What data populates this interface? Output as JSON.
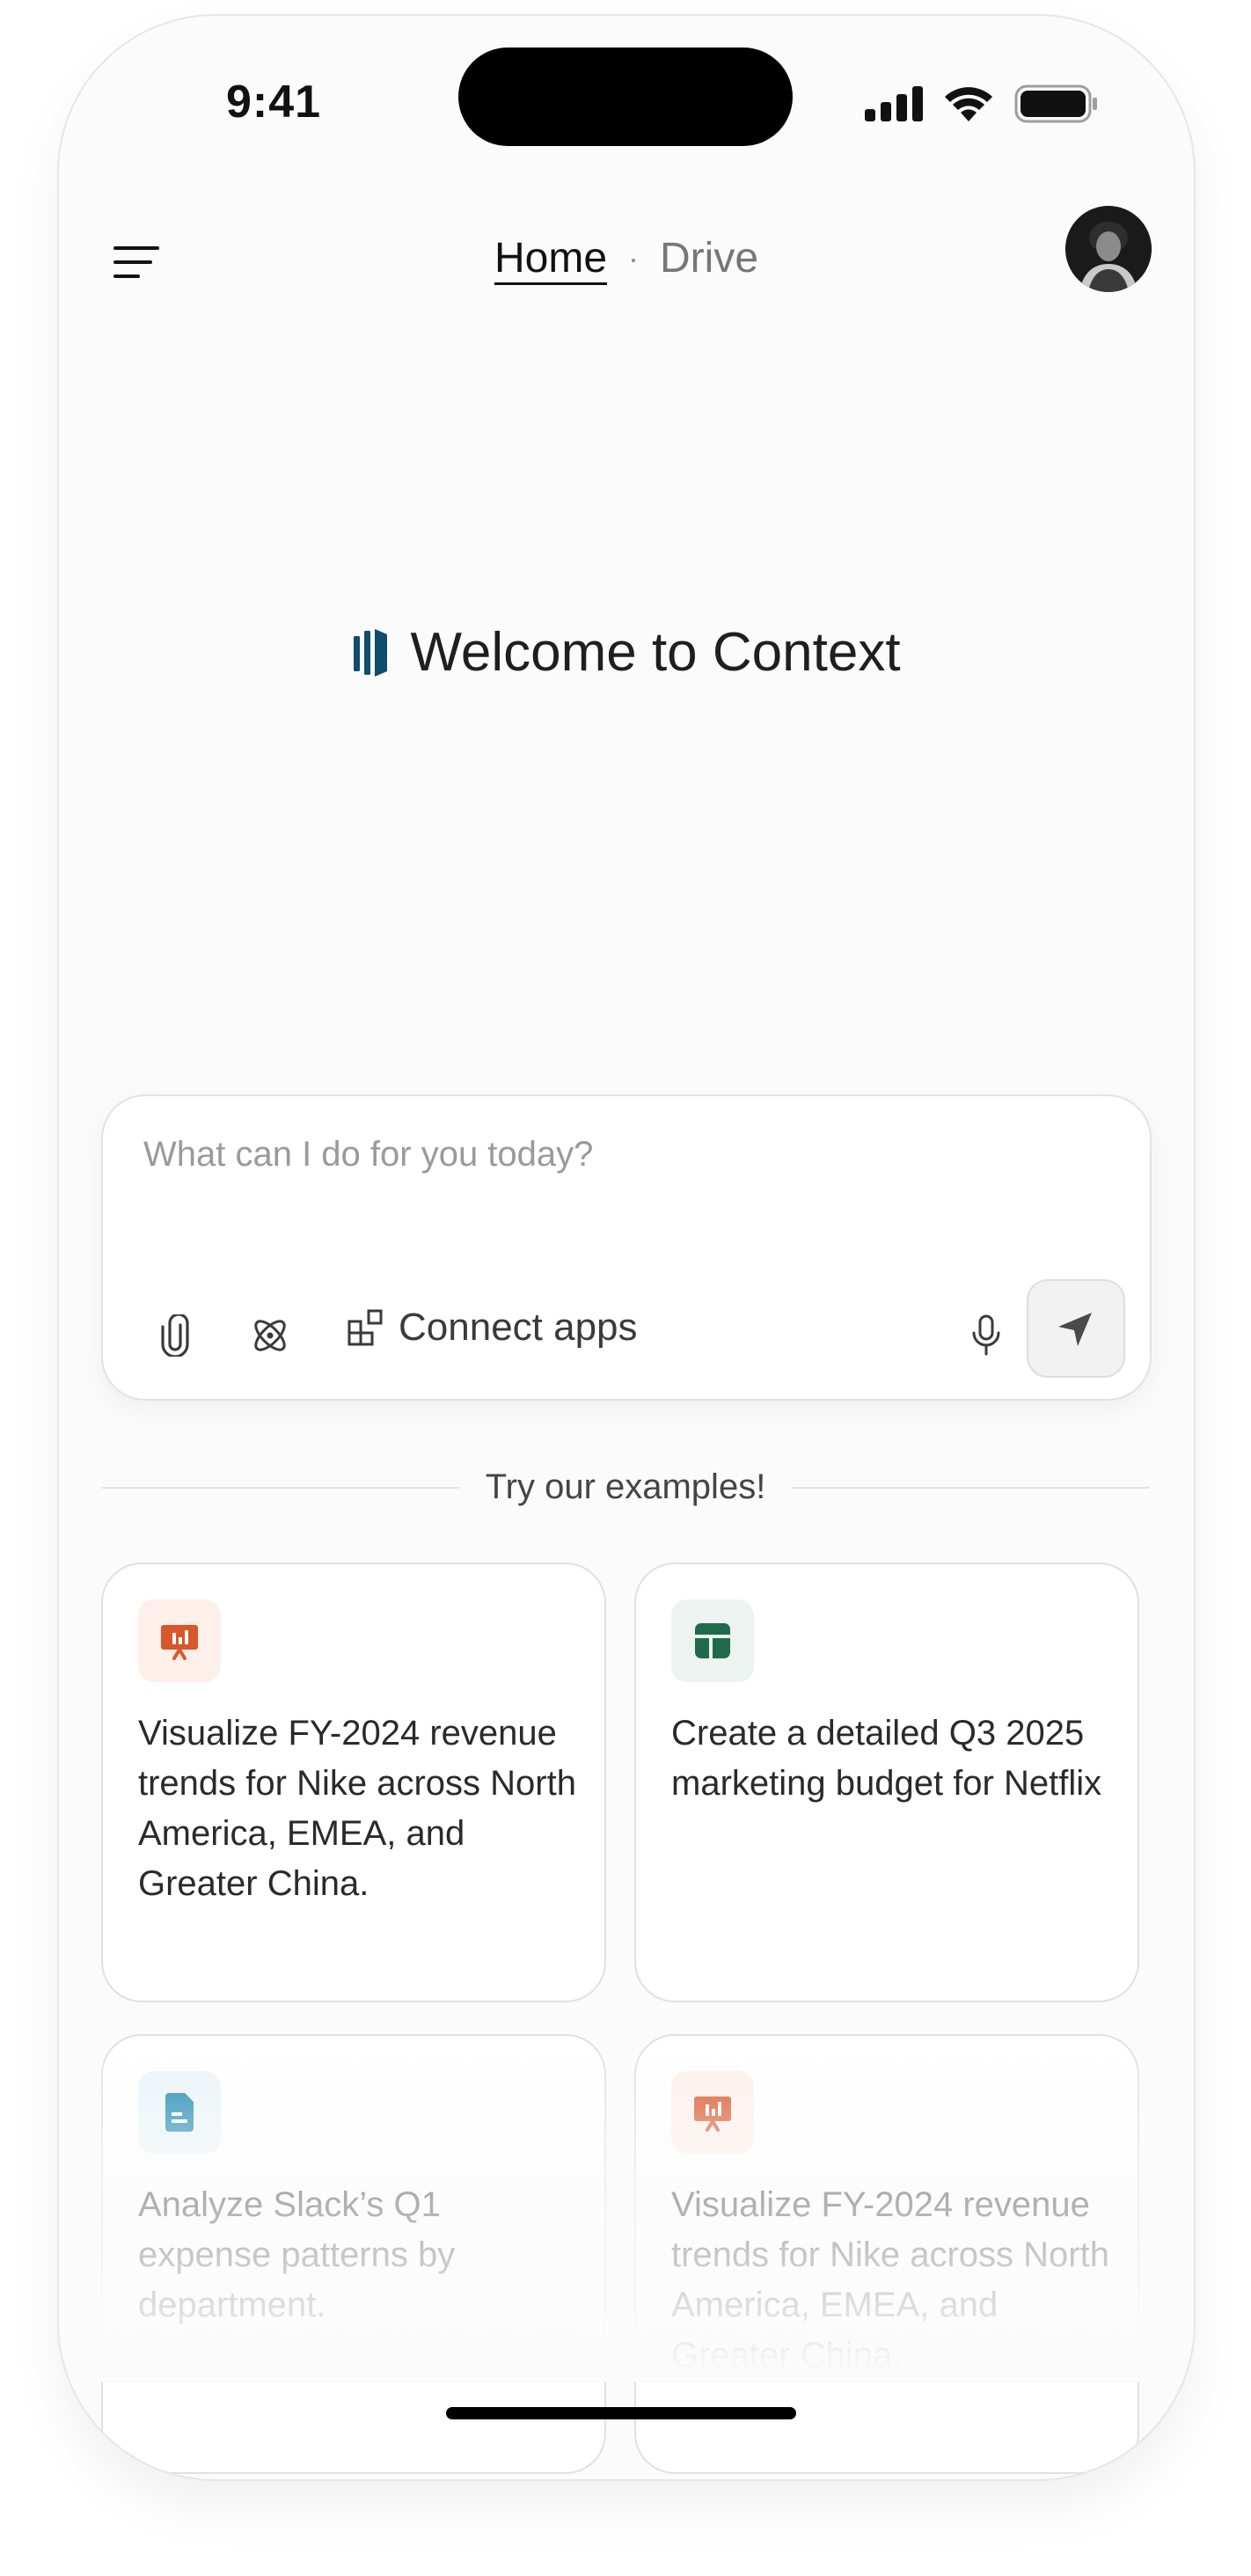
{
  "status_bar": {
    "time": "9:41"
  },
  "header": {
    "tabs": [
      {
        "label": "Home",
        "active": true
      },
      {
        "label": "Drive",
        "active": false
      }
    ],
    "separator": "·"
  },
  "welcome": {
    "title": "Welcome to Context",
    "logo_color": "#0f4c6e"
  },
  "composer": {
    "placeholder": "What can I do for you today?",
    "connect_label": "Connect apps",
    "icons": [
      "paperclip-icon",
      "atom-icon",
      "apps-icon",
      "microphone-icon",
      "send-icon"
    ]
  },
  "examples": {
    "heading": "Try our examples!",
    "cards": [
      {
        "text": "Visualize FY-2024 revenue trends for Nike across North America, EMEA, and Greater China.",
        "icon": "presentation-chart-icon",
        "accent": "#d9572b",
        "icon_bg": "#fdf0eb"
      },
      {
        "text": "Create a detailed Q3 2025 marketing budget for Netflix",
        "icon": "spreadsheet-icon",
        "accent": "#1e6b4c",
        "icon_bg": "#edf3f0"
      },
      {
        "text": "Analyze Slack’s Q1 expense patterns by department.",
        "icon": "document-icon",
        "accent": "#1f88b5",
        "icon_bg": "#ebf5f9"
      },
      {
        "text": "Visualize FY-2024 revenue trends for Nike across North America, EMEA, and Greater China.",
        "icon": "presentation-chart-icon",
        "accent": "#d9572b",
        "icon_bg": "#fdf0eb"
      }
    ]
  }
}
